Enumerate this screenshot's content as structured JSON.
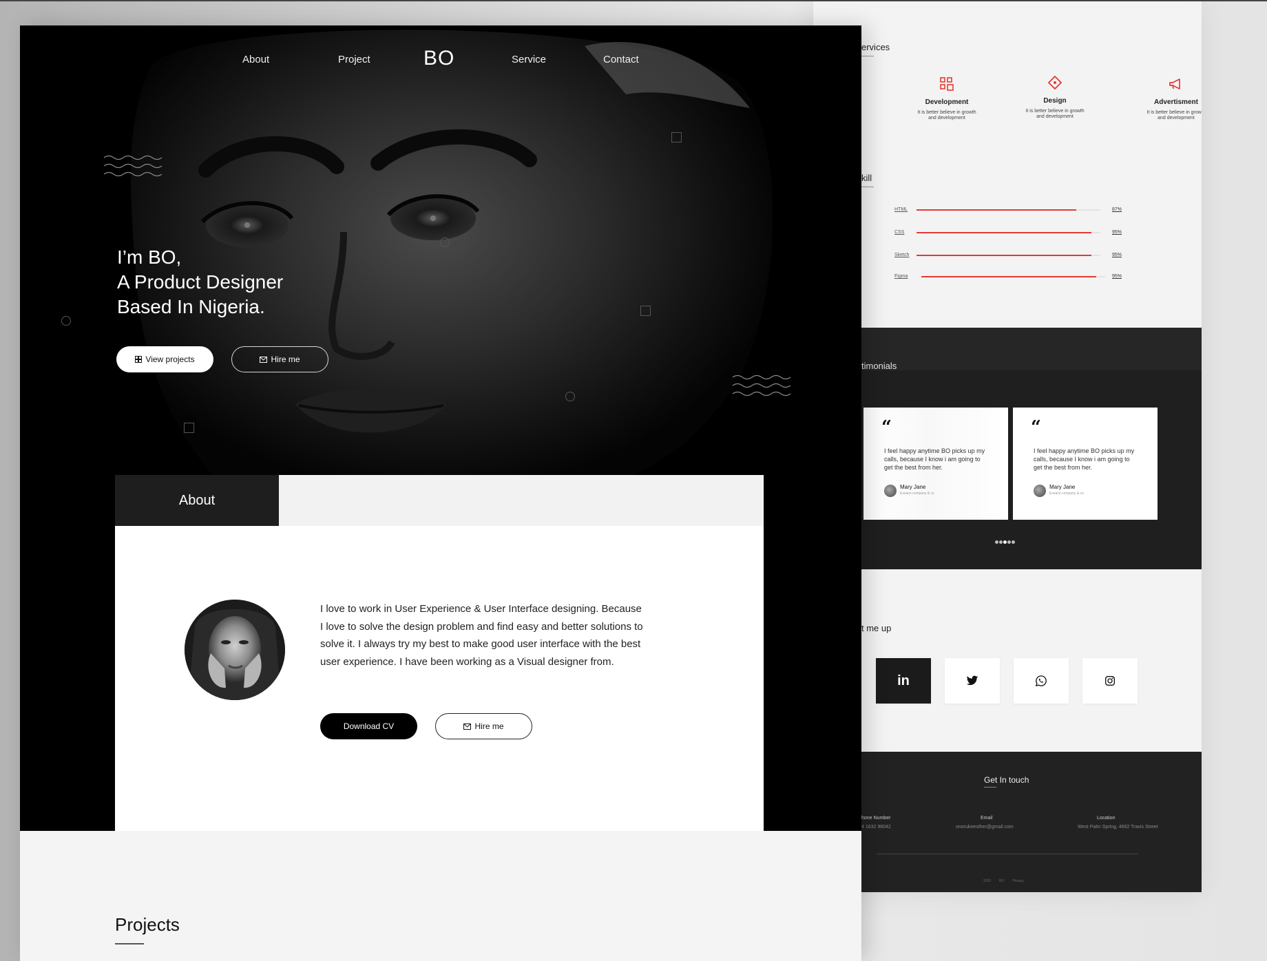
{
  "main": {
    "nav": {
      "about": "About",
      "project": "Project",
      "brand": "BO",
      "service": "Service",
      "contact": "Contact"
    },
    "hero": {
      "line1": "I’m BO,",
      "line2": "A Product Designer",
      "line3": "Based In Nigeria.",
      "view_projects": "View projects",
      "hire_me": "Hire me"
    },
    "about": {
      "tab": "About",
      "text": "I love to work in User Experience & User Interface designing. Because I love to solve the design problem and find easy and better solutions to solve it. I always try my best to make good user interface with the best user experience. I have been working as a Visual designer from.",
      "download_cv": "Download CV",
      "hire_me": "Hire me"
    },
    "projects": {
      "title": "Projects"
    }
  },
  "side": {
    "services": {
      "title": "ervices",
      "items": [
        {
          "name": "Development",
          "desc": "It is better believe in growth and development",
          "icon": "grid-icon"
        },
        {
          "name": "Design",
          "desc": "It is better believe in growth and development",
          "icon": "diamond-icon"
        },
        {
          "name": "Advertisment",
          "desc": "It is better believe in growth and development",
          "icon": "megaphone-icon"
        }
      ]
    },
    "skills": {
      "title": "kill",
      "items": [
        {
          "name": "HTML",
          "percent": 87,
          "label": "87%"
        },
        {
          "name": "CSS",
          "percent": 95,
          "label": "95%"
        },
        {
          "name": "Sketch",
          "percent": 95,
          "label": "95%"
        },
        {
          "name": "Figma",
          "percent": 95,
          "label": "95%"
        }
      ]
    },
    "testimonials": {
      "title": "timonials",
      "cards": [
        {
          "text": "I feel happy anytime BO picks up my calls,  because I know i am going to get the best from her.",
          "name": "Mary Jane",
          "role": "Exeace company & co"
        },
        {
          "text": "I feel happy anytime BO picks up my calls,  because I know i am going to get the best from her.",
          "name": "Mary Jane",
          "role": "Exeace company & co"
        }
      ],
      "dots": 5,
      "active_dot": 3
    },
    "hit_me_up": {
      "title": "t me up"
    },
    "footer": {
      "title": "Get In touch",
      "phone_label": "hone Number",
      "phone": "4 1632 96042",
      "email_label": "Email",
      "email": "onorukeesther@gmail.com",
      "location_label": "Location",
      "location": "West Palm Spring, 4662 Travis Street",
      "mini": [
        "2020",
        "BO",
        "Privacy"
      ]
    }
  },
  "colors": {
    "accent": "#e53935",
    "dark": "#1f1f1f",
    "page": "#f4f4f4"
  }
}
